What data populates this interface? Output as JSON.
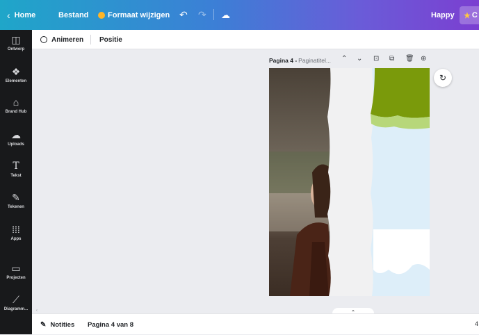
{
  "topbar": {
    "home": "Home",
    "bestand": "Bestand",
    "formaat": "Formaat wijzigen",
    "undo_icon": "undo-icon",
    "redo_icon": "redo-icon",
    "cloud_icon": "cloud-sync-icon",
    "happy": "Happy",
    "pro_initial": "C"
  },
  "sidebar": {
    "items": [
      {
        "label": "Ontwerp",
        "icon": "layout-icon"
      },
      {
        "label": "Elementen",
        "icon": "shapes-icon"
      },
      {
        "label": "Brand Hub",
        "icon": "brand-icon"
      },
      {
        "label": "Uploads",
        "icon": "upload-cloud-icon"
      },
      {
        "label": "Tekst",
        "icon": "text-icon"
      },
      {
        "label": "Tekenen",
        "icon": "draw-icon"
      },
      {
        "label": "Apps",
        "icon": "apps-grid-icon"
      },
      {
        "label": "Projecten",
        "icon": "folder-icon"
      },
      {
        "label": "Diagramm...",
        "icon": "chart-icon"
      }
    ]
  },
  "subbar": {
    "animeren": "Animeren",
    "positie": "Positie"
  },
  "page": {
    "label": "Pagina 4 -",
    "title_placeholder": "Paginatitel..."
  },
  "bottombar": {
    "notities": "Notities",
    "pagina": "Pagina 4 van 8",
    "edge_text": "4"
  },
  "colors": {
    "green": "#7a9a0b",
    "light_green": "#b7d77a",
    "light_blue": "#d6ecfb",
    "paper": "#f1f1f2"
  }
}
